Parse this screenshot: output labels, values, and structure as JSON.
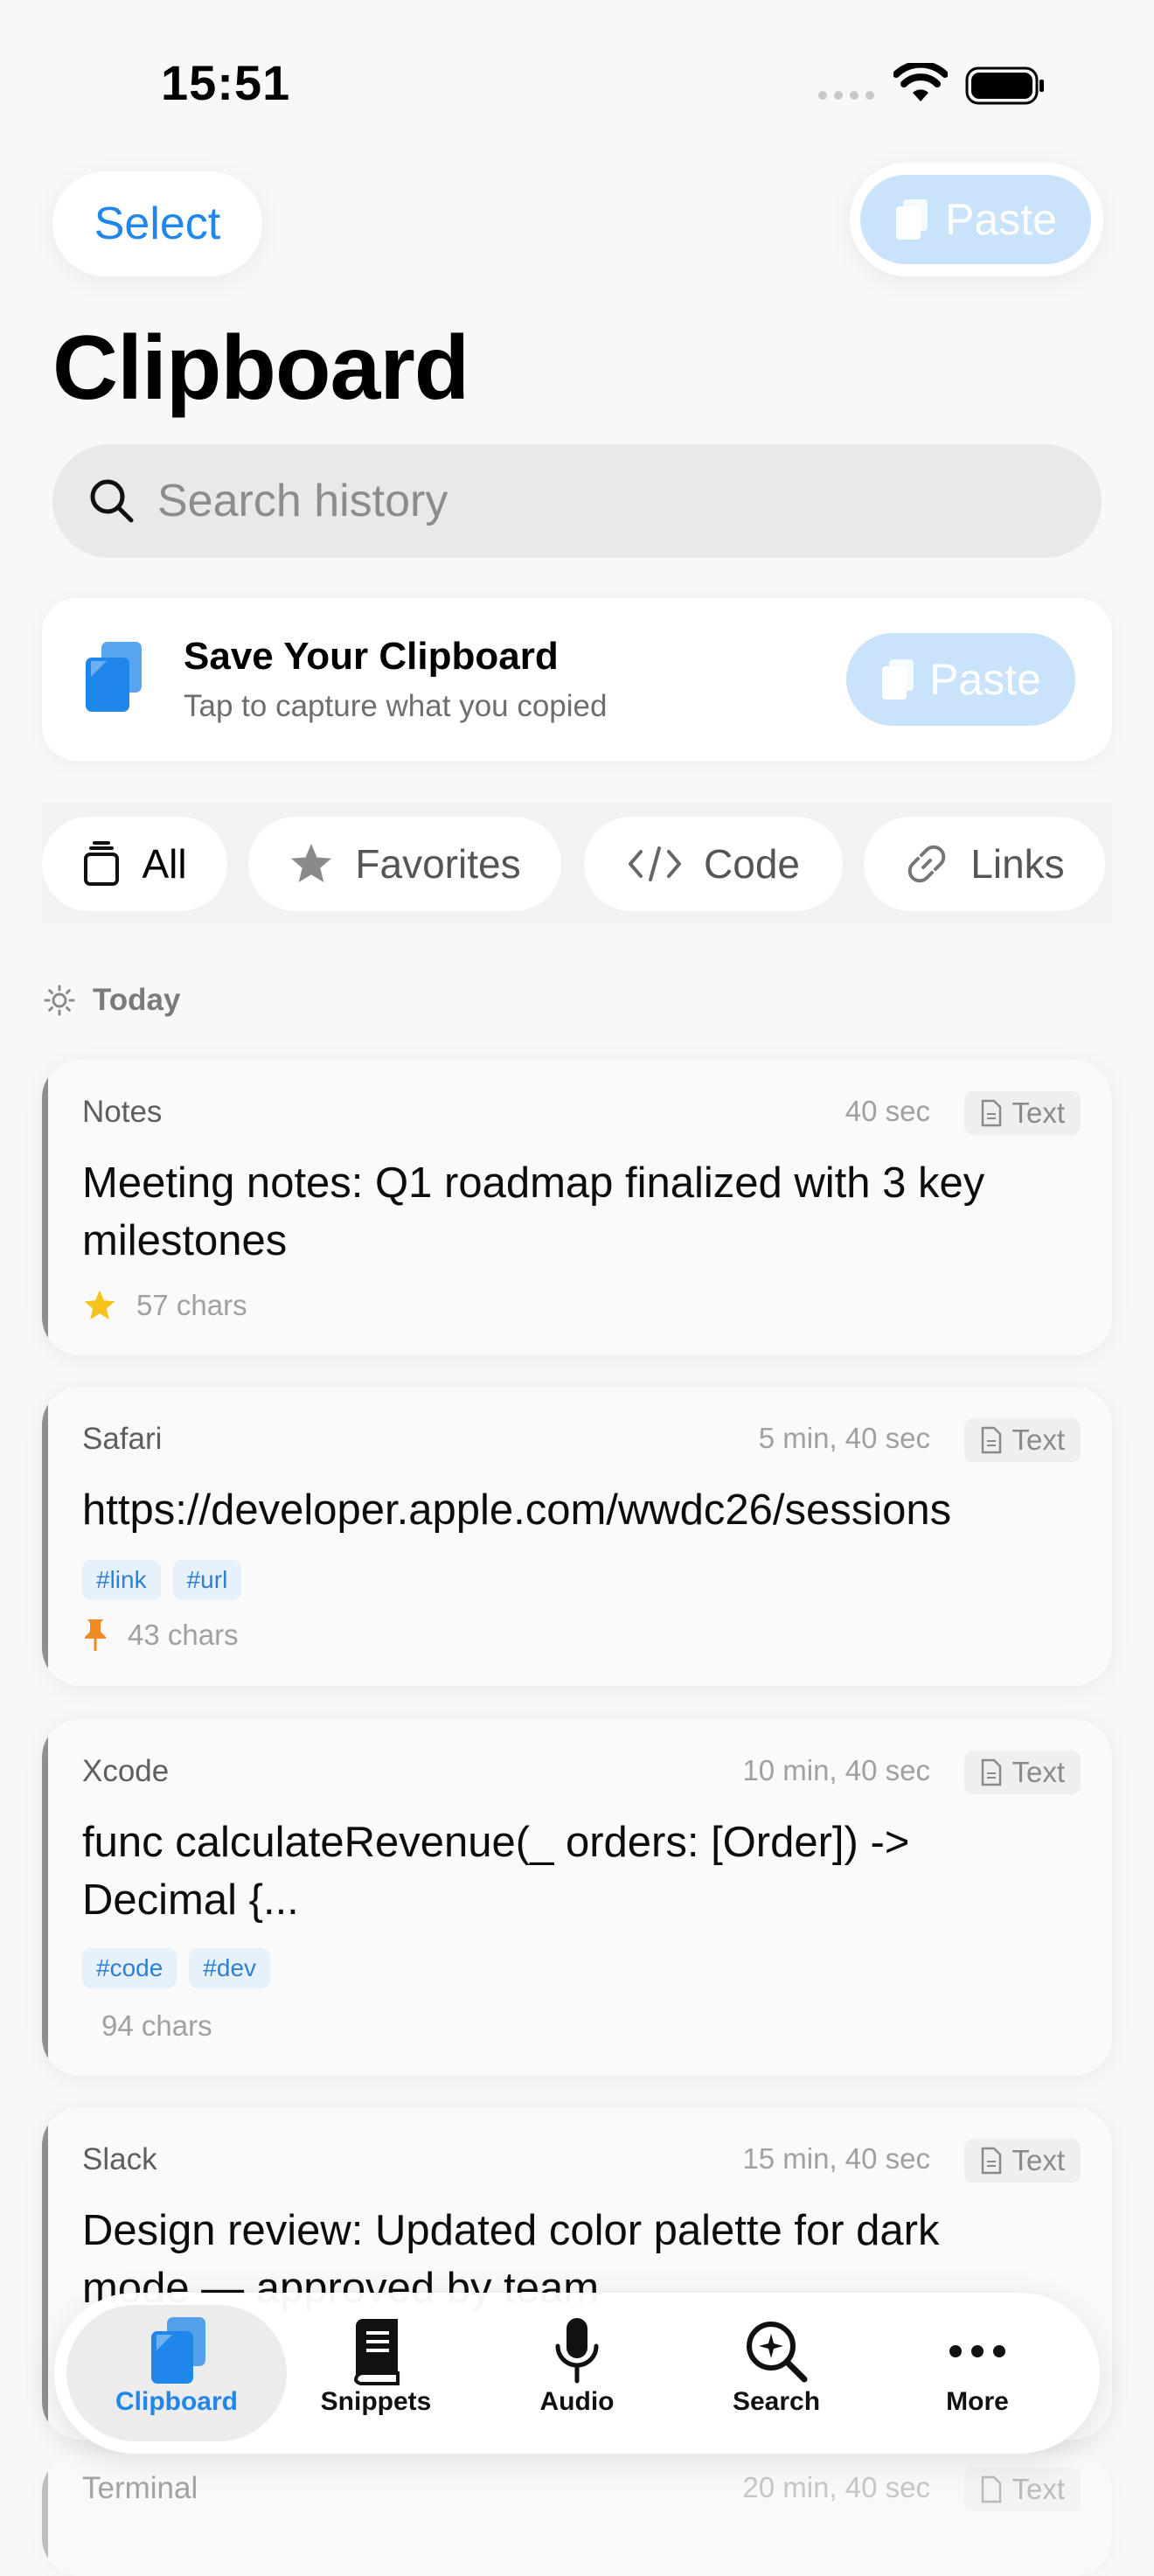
{
  "status_bar": {
    "time": "15:51"
  },
  "header": {
    "select_label": "Select",
    "paste_label": "Paste",
    "title": "Clipboard"
  },
  "search": {
    "placeholder": "Search history"
  },
  "save_card": {
    "title": "Save Your Clipboard",
    "subtitle": "Tap to capture what you copied",
    "paste_label": "Paste"
  },
  "filters": [
    {
      "label": "All",
      "icon": "stack-icon",
      "active": true
    },
    {
      "label": "Favorites",
      "icon": "star-icon"
    },
    {
      "label": "Code",
      "icon": "code-icon"
    },
    {
      "label": "Links",
      "icon": "link-icon"
    }
  ],
  "section": {
    "label": "Today",
    "icon": "sun-icon"
  },
  "clips": [
    {
      "source": "Notes",
      "ago": "40 sec",
      "kind": "Text",
      "text": "Meeting notes: Q1 roadmap finalized with 3 key milestones",
      "tags": [],
      "marker": "star",
      "chars": "57 chars"
    },
    {
      "source": "Safari",
      "ago": "5 min, 40 sec",
      "kind": "Text",
      "text": "https://developer.apple.com/wwdc26/sessions",
      "tags": [
        "#link",
        "#url"
      ],
      "marker": "pin",
      "chars": "43 chars"
    },
    {
      "source": "Xcode",
      "ago": "10 min, 40 sec",
      "kind": "Text",
      "text": "func calculateRevenue(_ orders: [Order]) -> Decimal {...",
      "tags": [
        "#code",
        "#dev"
      ],
      "marker": "",
      "chars": "94 chars"
    },
    {
      "source": "Slack",
      "ago": "15 min, 40 sec",
      "kind": "Text",
      "text": "Design review: Updated color palette for dark mode — approved by team"
    },
    {
      "source": "Terminal",
      "ago": "20 min, 40 sec",
      "kind": "Text"
    }
  ],
  "tabbar": [
    {
      "label": "Clipboard",
      "icon": "clipboard-icon",
      "active": true
    },
    {
      "label": "Snippets",
      "icon": "book-icon"
    },
    {
      "label": "Audio",
      "icon": "microphone-icon"
    },
    {
      "label": "Search",
      "icon": "sparkle-search-icon"
    },
    {
      "label": "More",
      "icon": "ellipsis-icon"
    }
  ],
  "colors": {
    "accent": "#1f86ea",
    "paste_disabled": "#c9e3fb",
    "star": "#f6c21c",
    "pin": "#f08a24"
  }
}
